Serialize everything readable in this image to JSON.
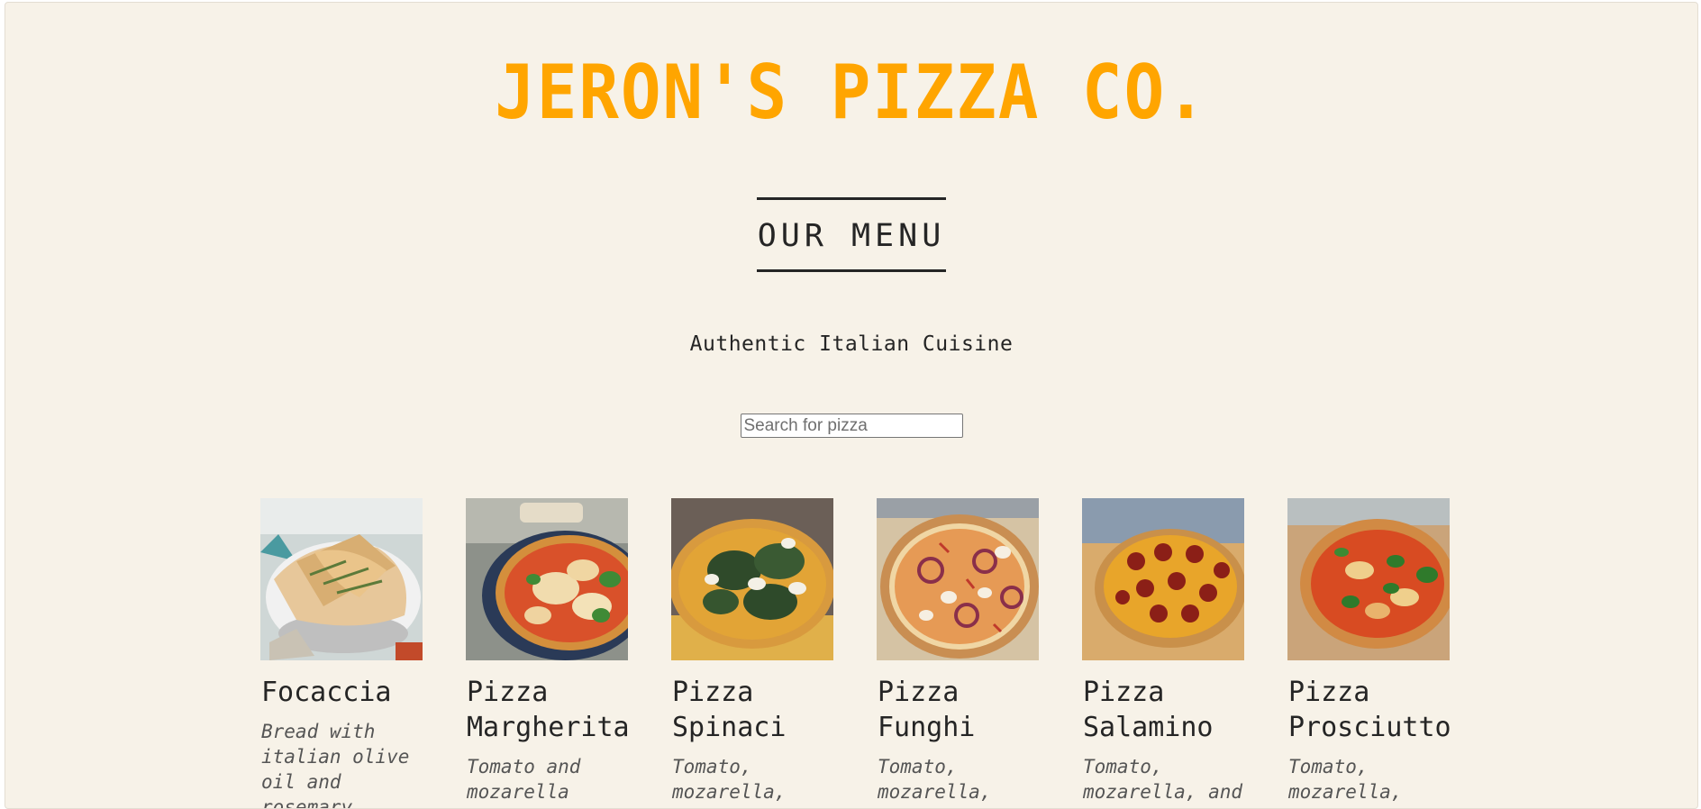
{
  "header": {
    "title": "JERON'S PIZZA CO.",
    "title_color": "#ffa500"
  },
  "menu": {
    "heading": "OUR MENU",
    "tagline": "Authentic Italian Cuisine"
  },
  "search": {
    "placeholder": "Search for pizza",
    "value": ""
  },
  "pizzas": [
    {
      "name": "Focaccia",
      "description": "Bread with italian olive oil and rosemary"
    },
    {
      "name": "Pizza Margherita",
      "description": "Tomato and mozarella"
    },
    {
      "name": "Pizza Spinaci",
      "description": "Tomato, mozarella,"
    },
    {
      "name": "Pizza Funghi",
      "description": "Tomato, mozarella,"
    },
    {
      "name": "Pizza Salamino",
      "description": "Tomato, mozarella, and"
    },
    {
      "name": "Pizza Prosciutto",
      "description": "Tomato, mozarella,"
    }
  ],
  "colors": {
    "background": "#f7f2e8",
    "text": "#252525",
    "accent": "#ffa500"
  }
}
